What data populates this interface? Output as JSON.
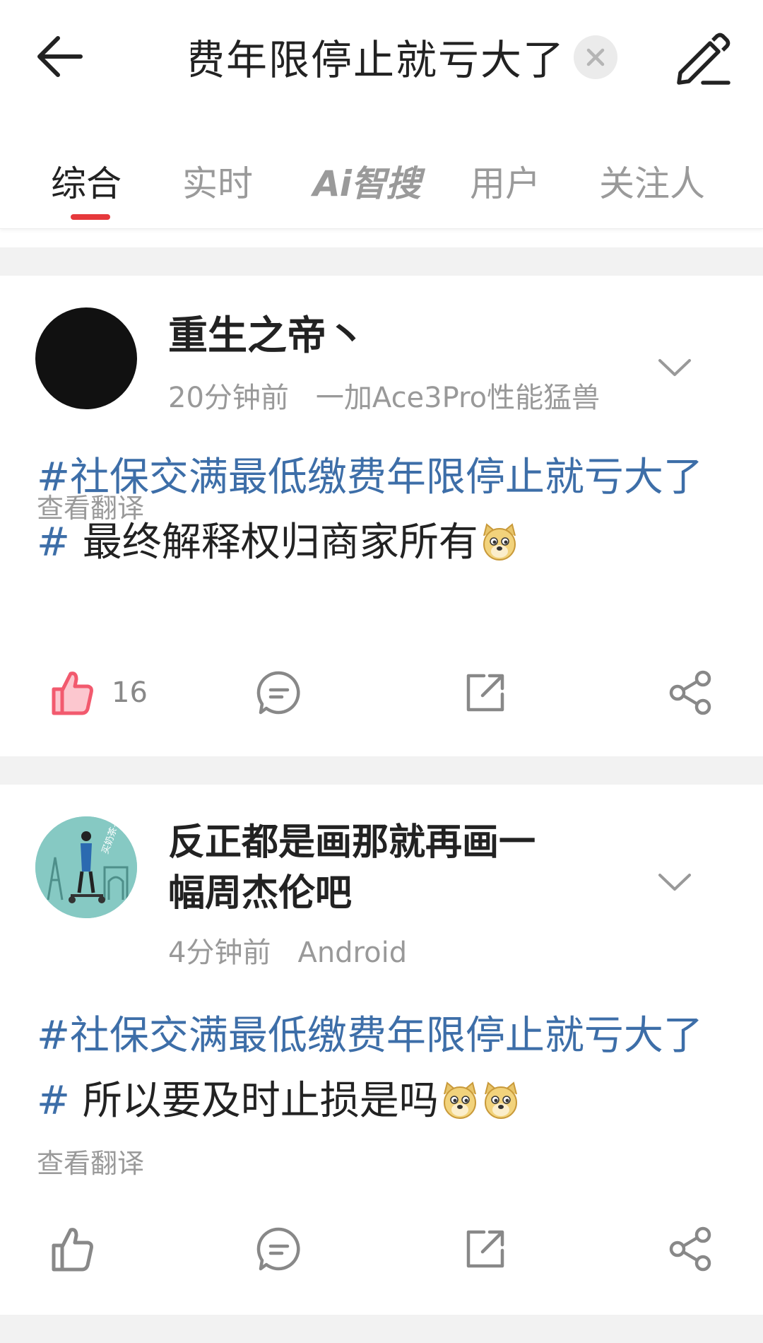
{
  "header": {
    "search_query": "社保交满最低缴费年限停止就亏大了",
    "back_icon": "arrow-left-icon",
    "clear_icon": "close-icon",
    "edit_icon": "pencil-icon"
  },
  "tabs": [
    {
      "label": "综合",
      "active": true
    },
    {
      "label": "实时",
      "active": false
    },
    {
      "label": "Ai智搜",
      "active": false
    },
    {
      "label": "用户",
      "active": false
    },
    {
      "label": "关注人",
      "active": false
    }
  ],
  "colors": {
    "accent": "#e6393c",
    "hashtag": "#3d6ea8",
    "like_active": "#f25a6e"
  },
  "posts": [
    {
      "username": "重生之帝丶",
      "time": "20分钟前",
      "device": "一加Ace3Pro性能猛兽",
      "hashtag": "#社保交满最低缴费年限停止就亏大了#",
      "text": " 最终解释权归商家所有",
      "emoji_count": 1,
      "translate": "查看翻译",
      "like_count": "16",
      "liked": true
    },
    {
      "username": "反正都是画那就再画一幅周杰伦吧",
      "time": "4分钟前",
      "device": "Android",
      "hashtag": "#社保交满最低缴费年限停止就亏大了#",
      "text": " 所以要及时止损是吗",
      "emoji_count": 2,
      "translate": "查看翻译",
      "avatar_text": "买奶茶~",
      "like_count": "",
      "liked": false
    }
  ]
}
